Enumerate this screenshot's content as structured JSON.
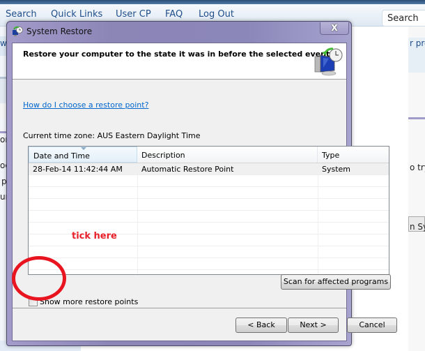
{
  "browser_nav": {
    "links": [
      "Search",
      "Quick Links",
      "User CP",
      "FAQ",
      "Log Out"
    ],
    "search_label": "Search"
  },
  "background_fragments": {
    "right": [
      "r pro",
      "o try",
      "n Sy"
    ],
    "left": [
      "w.",
      "on",
      "oc",
      "p",
      "ur"
    ]
  },
  "window": {
    "title": "System Restore",
    "close_label": "X",
    "header_title": "Restore your computer to the state it was in before the selected event",
    "help_link": "How do I choose a restore point?",
    "timezone": "Current time zone: AUS Eastern Daylight Time",
    "table": {
      "columns": [
        "Date and Time",
        "Description",
        "Type"
      ],
      "rows": [
        {
          "date": "28-Feb-14 11:42:44 AM",
          "description": "Automatic Restore Point",
          "type": "System"
        }
      ]
    },
    "annotation": "tick here",
    "show_more_label": "Show more restore points",
    "show_more_checked": false,
    "scan_button": "Scan for affected programs",
    "back_button": "< Back",
    "next_button": "Next >",
    "cancel_button": "Cancel"
  },
  "colors": {
    "annotation": "#e8202a",
    "link": "#0066cc",
    "title_bar": "#8b87b9"
  }
}
